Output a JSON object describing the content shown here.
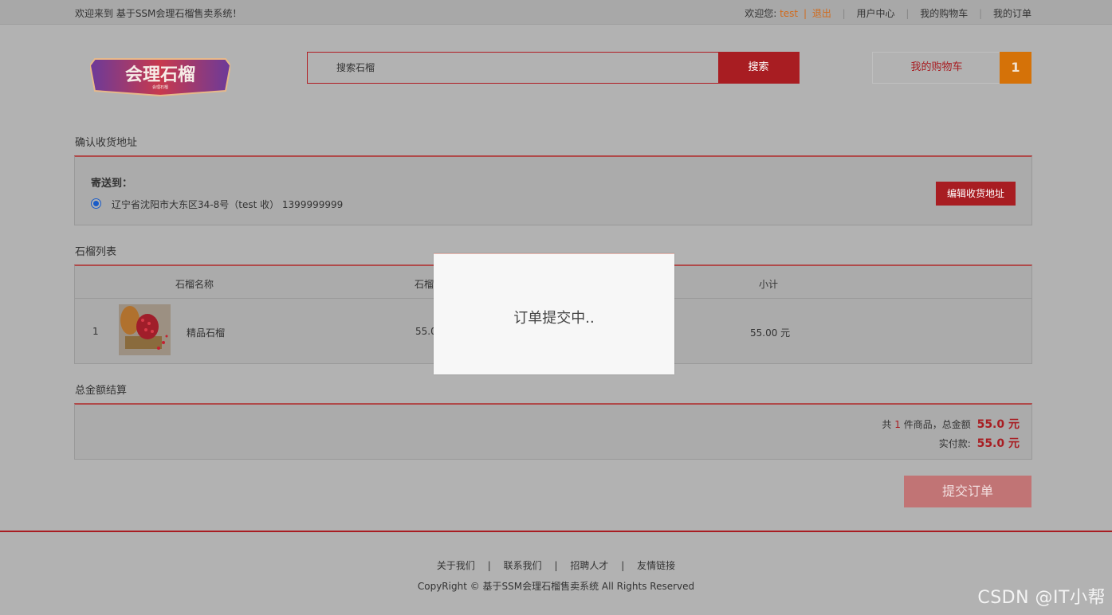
{
  "topbar": {
    "welcome": "欢迎来到 基于SSM会理石榴售卖系统！",
    "greeting": "欢迎您:",
    "username": "test",
    "divider": "|",
    "logout": "退出",
    "nav": [
      "用户中心",
      "我的购物车",
      "我的订单"
    ],
    "nav_sep": "|"
  },
  "header": {
    "logo_text": "会理石榴",
    "logo_subtext": "会理石榴",
    "search_placeholder": "搜索石榴",
    "search_button": "搜索",
    "cart_label": "我的购物车",
    "cart_count": "1"
  },
  "address": {
    "title": "确认收货地址",
    "send_to": "寄送到：",
    "address_line": "辽宁省沈阳市大东区34-8号（test 收） 1399999999",
    "edit_button": "编辑收货地址"
  },
  "product_list": {
    "title": "石榴列表",
    "headers": {
      "name": "石榴名称",
      "price": "石榴",
      "subtotal": "小计"
    },
    "rows": [
      {
        "index": "1",
        "name": "精品石榴",
        "price": "55.0",
        "subtotal": "55.00 元"
      }
    ]
  },
  "summary": {
    "title": "总金额结算",
    "prefix": "共",
    "count": "1",
    "middle": "件商品，总金额",
    "total": "55.0 元",
    "paid_label": "实付款:",
    "paid": "55.0 元",
    "submit_button": "提交订单"
  },
  "footer": {
    "links": [
      "关于我们",
      "联系我们",
      "招聘人才",
      "友情链接"
    ],
    "link_sep": "|",
    "copyright": "CopyRight © 基于SSM会理石榴售卖系统 All Rights Reserved"
  },
  "watermark": "CSDN @IT小帮",
  "modal": {
    "message": "订单提交中.."
  },
  "colors": {
    "brand_red": "#a81d22",
    "orange": "#d57208",
    "overlay_gray": "#b2b2b2"
  }
}
